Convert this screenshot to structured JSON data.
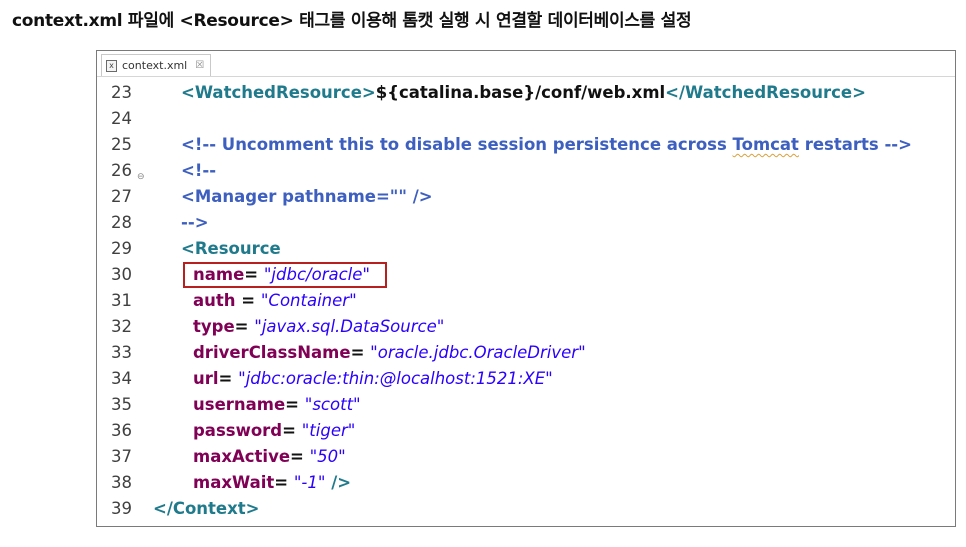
{
  "slide": {
    "title": "context.xml 파일에 <Resource> 태그를 이용해 톰캣 실행 시 연결할 데이터베이스를 설정"
  },
  "editor": {
    "tab_label": "context.xml",
    "tab_icon": "x",
    "close_glyph": "☒"
  },
  "code": {
    "l23": {
      "num": "23",
      "open_tag": "<WatchedResource>",
      "text": "${catalina.base}/conf/web.xml",
      "close_tag": "</WatchedResource>"
    },
    "l24": {
      "num": "24"
    },
    "l25": {
      "num": "25",
      "c1": "<!-- Uncomment this to disable session persistence across ",
      "c2": "Tomcat",
      "c3": " restarts -->"
    },
    "l26": {
      "num": "26",
      "fold": "⊖",
      "text": "<!--"
    },
    "l27": {
      "num": "27",
      "text": "<Manager pathname=\"\" />"
    },
    "l28": {
      "num": "28",
      "text": "-->"
    },
    "l29": {
      "num": "29",
      "text": "<Resource"
    },
    "l30": {
      "num": "30",
      "attr": "name",
      "eq": "=",
      "val": "\"jdbc/oracle\""
    },
    "l31": {
      "num": "31",
      "attr": "auth",
      "eq": " =",
      "val": "\"Container\""
    },
    "l32": {
      "num": "32",
      "attr": "type",
      "eq": "=",
      "val": "\"javax.sql.DataSource\""
    },
    "l33": {
      "num": "33",
      "attr": "driverClassName",
      "eq": "=",
      "val": "\"oracle.jdbc.OracleDriver\""
    },
    "l34": {
      "num": "34",
      "attr": "url",
      "eq": "=",
      "val": "\"jdbc:oracle:thin:@localhost:1521:XE\""
    },
    "l35": {
      "num": "35",
      "attr": "username",
      "eq": "=",
      "val": "\"scott\""
    },
    "l36": {
      "num": "36",
      "attr": "password",
      "eq": "=",
      "val": "\"tiger\""
    },
    "l37": {
      "num": "37",
      "attr": "maxActive",
      "eq": "=",
      "val": "\"50\""
    },
    "l38": {
      "num": "38",
      "attr": "maxWait",
      "eq": "=",
      "val": "\"-1\"",
      "end": " />"
    },
    "l39": {
      "num": "39",
      "text": "</Context>"
    }
  },
  "colors": {
    "tag": "#1f7a8c",
    "comment": "#3d5fbf",
    "attribute": "#7f0055",
    "value": "#2a00ff",
    "highlight_border": "#b82020"
  }
}
